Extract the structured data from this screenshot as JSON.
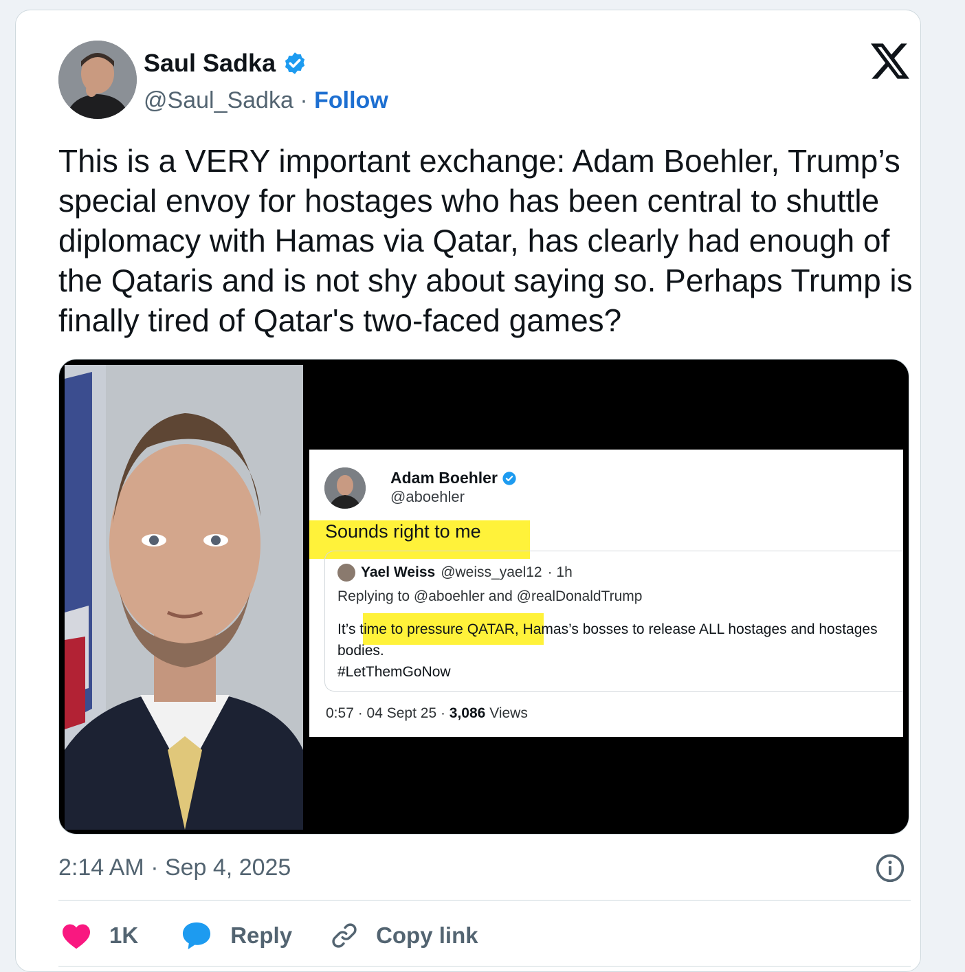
{
  "author": {
    "name": "Saul Sadka",
    "handle": "@Saul_Sadka",
    "separator": "·",
    "follow_label": "Follow",
    "verified": true
  },
  "platform_logo": "x-logo-icon",
  "tweet": {
    "text": "This is a VERY important exchange: Adam Boehler, Trump’s special envoy for hostages who has been central to shuttle diplomacy with Hamas via Qatar, has clearly had enough of the Qataris and is not shy about saying so. Perhaps Trump is finally tired of Qatar's two-faced games?"
  },
  "media": {
    "embedded_post": {
      "name": "Adam Boehler",
      "handle": "@aboehler",
      "text": "Sounds right to me",
      "quote": {
        "name": "Yael Weiss",
        "handle": "@weiss_yael12",
        "age": "· 1h",
        "replying_to": "Replying to @aboehler and @realDonaldTrump",
        "body_pre": "It’s ",
        "body_highlight": "time to pressure QATAR,",
        "body_post": " Hamas’s bosses to release ALL hostages and hostages bodies.",
        "hashtag": "#LetThemGoNow"
      },
      "time_date": "0:57 · 04 Sept 25 ·",
      "views_count": "3,086",
      "views_label": "Views"
    },
    "highlight_color": "#fff23a"
  },
  "timestamp": "2:14 AM · Sep 4, 2025",
  "actions": {
    "like_count": "1K",
    "reply_label": "Reply",
    "copy_label": "Copy link"
  },
  "colors": {
    "accent": "#1d9bf0",
    "like": "#f91880",
    "text": "#0f1419",
    "muted": "#536471"
  }
}
